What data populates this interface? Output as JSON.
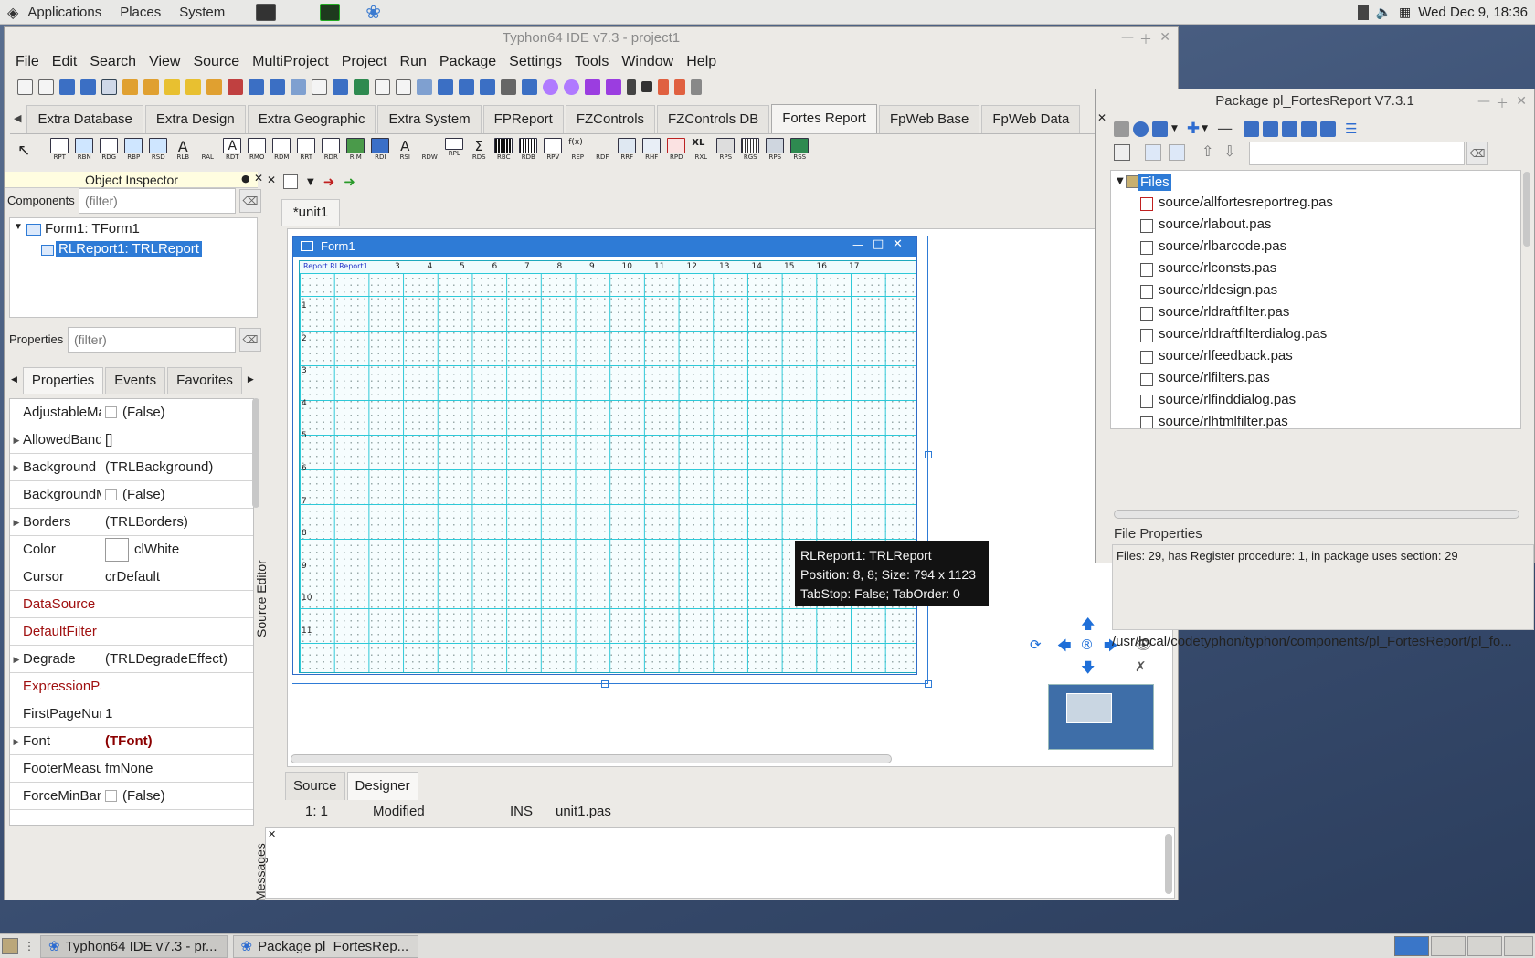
{
  "top_panel": {
    "menus": [
      "Applications",
      "Places",
      "System"
    ],
    "clock": "Wed Dec  9, 18:36"
  },
  "ide": {
    "title": "Typhon64 IDE v7.3 - project1",
    "menu": [
      "File",
      "Edit",
      "Search",
      "View",
      "Source",
      "MultiProject",
      "Project",
      "Run",
      "Package",
      "Settings",
      "Tools",
      "Window",
      "Help"
    ],
    "palette_tabs": [
      "Extra Database",
      "Extra Design",
      "Extra Geographic",
      "Extra System",
      "FPReport",
      "FZControls",
      "FZControls DB",
      "Fortes Report",
      "FpWeb Base",
      "FpWeb Data"
    ],
    "active_palette_tab": "Fortes Report",
    "palette_components": [
      "RPT",
      "RBN",
      "RDG",
      "RBP",
      "RSD",
      "RLB",
      "RAL",
      "RDT",
      "RMO",
      "RDM",
      "RRT",
      "RDR",
      "RIM",
      "RDI",
      "RSI",
      "RDW",
      "RPL",
      "RDS",
      "RBC",
      "RDB",
      "RPV",
      "REP",
      "RDF",
      "RRF",
      "RHF",
      "RPD",
      "RXL",
      "RPS",
      "RGS",
      "RPS",
      "RSS"
    ]
  },
  "object_inspector": {
    "title": "Object Inspector",
    "components_label": "Components",
    "filter_placeholder": "(filter)",
    "tree": [
      "Form1: TForm1",
      "RLReport1: TRLReport"
    ],
    "properties_label": "Properties",
    "tabs": [
      "Properties",
      "Events",
      "Favorites"
    ],
    "properties": [
      {
        "name": "AdjustableMa",
        "value": "(False)",
        "checkbox": true,
        "expandable": false,
        "event": false
      },
      {
        "name": "AllowedBand",
        "value": "[]",
        "checkbox": false,
        "expandable": true,
        "event": false
      },
      {
        "name": "Background",
        "value": "(TRLBackground)",
        "checkbox": false,
        "expandable": true,
        "event": false
      },
      {
        "name": "BackgroundM",
        "value": "(False)",
        "checkbox": true,
        "expandable": false,
        "event": false
      },
      {
        "name": "Borders",
        "value": "(TRLBorders)",
        "checkbox": false,
        "expandable": true,
        "event": false
      },
      {
        "name": "Color",
        "value": "clWhite",
        "checkbox": false,
        "expandable": false,
        "event": false,
        "color_swatch": "#ffffff"
      },
      {
        "name": "Cursor",
        "value": "crDefault",
        "checkbox": false,
        "expandable": false,
        "event": false
      },
      {
        "name": "DataSource",
        "value": "",
        "checkbox": false,
        "expandable": false,
        "event": true
      },
      {
        "name": "DefaultFilter",
        "value": "",
        "checkbox": false,
        "expandable": false,
        "event": true
      },
      {
        "name": "Degrade",
        "value": "(TRLDegradeEffect)",
        "checkbox": false,
        "expandable": true,
        "event": false
      },
      {
        "name": "ExpressionPa",
        "value": "",
        "checkbox": false,
        "expandable": false,
        "event": true
      },
      {
        "name": "FirstPageNur",
        "value": "1",
        "checkbox": false,
        "expandable": false,
        "event": false
      },
      {
        "name": "Font",
        "value": "(TFont)",
        "checkbox": false,
        "expandable": true,
        "event": false,
        "bold": true
      },
      {
        "name": "FooterMeasu",
        "value": "fmNone",
        "checkbox": false,
        "expandable": false,
        "event": false
      },
      {
        "name": "ForceMinBan",
        "value": "(False)",
        "checkbox": true,
        "expandable": false,
        "event": false
      }
    ]
  },
  "editor": {
    "source_editor_label": "Source Editor",
    "unit_tab": "*unit1",
    "form_title": "Form1",
    "report_caption": "Report RLReport1",
    "ruler_x": [
      "3",
      "4",
      "5",
      "6",
      "7",
      "8",
      "9",
      "10",
      "11",
      "12",
      "13",
      "14",
      "15",
      "16",
      "17"
    ],
    "ruler_y": [
      "1",
      "2",
      "3",
      "4",
      "5",
      "6",
      "7",
      "8",
      "9",
      "10",
      "11"
    ],
    "tooltip": {
      "line1": "RLReport1: TRLReport",
      "line2": "Position: 8, 8; Size: 794 x 1123",
      "line3": "TabStop: False; TabOrder: 0"
    },
    "bottom_tabs": [
      "Source",
      "Designer"
    ],
    "active_bottom_tab": "Designer",
    "status": {
      "position": "1:  1",
      "modified": "Modified",
      "mode": "INS",
      "file": "unit1.pas"
    },
    "messages_label": "Messages"
  },
  "package_window": {
    "title": "Package pl_FortesReport V7.3.1",
    "root": "Files",
    "files": [
      "source/allfortesreportreg.pas",
      "source/rlabout.pas",
      "source/rlbarcode.pas",
      "source/rlconsts.pas",
      "source/rldesign.pas",
      "source/rldraftfilter.pas",
      "source/rldraftfilterdialog.pas",
      "source/rlfeedback.pas",
      "source/rlfilters.pas",
      "source/rlfinddialog.pas",
      "source/rlhtmlfilter.pas"
    ],
    "file_properties_title": "File Properties",
    "file_properties_text": "Files: 29, has Register procedure: 1, in package uses section: 29",
    "path": "/usr/local/codetyphon/typhon/components/pl_FortesReport/pl_fo..."
  },
  "taskbar": {
    "items": [
      "Typhon64 IDE v7.3 - pr...",
      "Package pl_FortesRep..."
    ]
  },
  "colors": {
    "accent": "#2e7bd6",
    "grid": "#2ec9d8",
    "event_property": "#a01010"
  }
}
